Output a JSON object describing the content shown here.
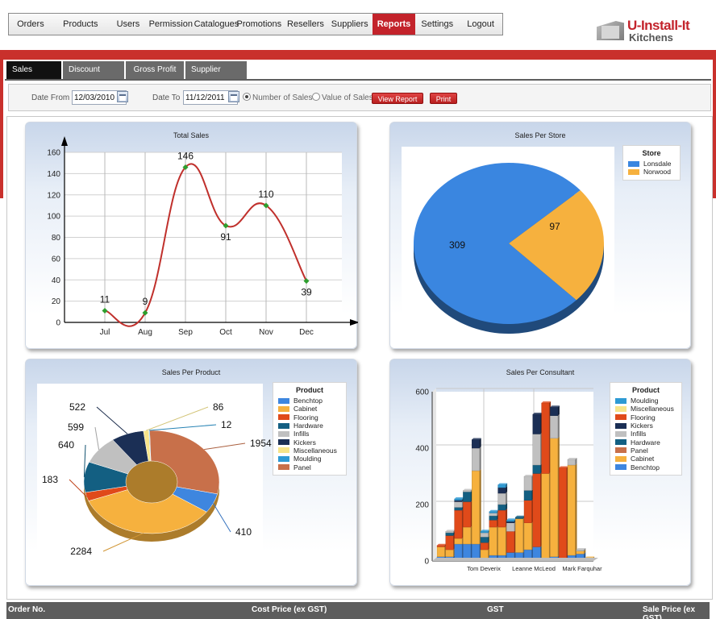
{
  "nav": {
    "items": [
      {
        "label": "Orders",
        "active": false
      },
      {
        "label": "Products",
        "active": false
      },
      {
        "label": "Users",
        "active": false
      },
      {
        "label": "Permission",
        "active": false
      },
      {
        "label": "Catalogues",
        "active": false
      },
      {
        "label": "Promotions",
        "active": false
      },
      {
        "label": "Resellers",
        "active": false
      },
      {
        "label": "Suppliers",
        "active": false
      },
      {
        "label": "Reports",
        "active": true
      },
      {
        "label": "Settings",
        "active": false
      },
      {
        "label": "Logout",
        "active": false
      }
    ]
  },
  "logo": {
    "line1": "U-Install-It",
    "line2": "Kitchens"
  },
  "tabs": [
    "Sales Report",
    "Discount Report",
    "Gross Profit",
    "Supplier Report"
  ],
  "filter": {
    "date_from_label": "Date From",
    "date_from": "12/03/2010",
    "date_to_label": "Date To",
    "date_to": "11/12/2011",
    "radio_number": "Number of Sales",
    "radio_value": "Value of Sales",
    "view_button": "View Report",
    "print_button": "Print"
  },
  "table_header": {
    "order_no": "Order No.",
    "cost_price": "Cost Price (ex GST)",
    "gst": "GST",
    "sale_price": "Sale Price (ex GST)"
  },
  "colors": {
    "accent": "#c3232b",
    "line": "#c0302c",
    "marker": "#2e9e2e"
  },
  "chart_data": [
    {
      "type": "line",
      "title": "Total Sales",
      "categories": [
        "Jul",
        "Aug",
        "Sep",
        "Oct",
        "Nov",
        "Dec"
      ],
      "values": [
        11,
        9,
        146,
        91,
        110,
        39
      ],
      "data_labels": [
        "11",
        "9",
        "146",
        "91",
        "110",
        "39"
      ],
      "ylim": [
        0,
        160
      ],
      "yticks": [
        "0",
        "20",
        "40",
        "60",
        "80",
        "100",
        "120",
        "140",
        "160"
      ],
      "grid": true
    },
    {
      "type": "pie",
      "title": "Sales Per Store",
      "legend_title": "Store",
      "legend": "top-right",
      "slices": [
        {
          "name": "Lonsdale",
          "value": 309,
          "label": "309",
          "color": "#3a86e0"
        },
        {
          "name": "Norwood",
          "value": 97,
          "label": "97",
          "color": "#f6b13e"
        }
      ]
    },
    {
      "type": "pie",
      "title": "Sales Per Product",
      "legend_title": "Product",
      "legend": "right",
      "slices": [
        {
          "name": "Panel",
          "value": 1954,
          "label": "1954",
          "color": "#c8704a"
        },
        {
          "name": "Benchtop",
          "value": 410,
          "label": "410",
          "color": "#3e86df"
        },
        {
          "name": "Cabinet",
          "value": 2284,
          "label": "2284",
          "color": "#f6b13e"
        },
        {
          "name": "Flooring",
          "value": 183,
          "label": "183",
          "color": "#e04a1a"
        },
        {
          "name": "Hardware",
          "value": 640,
          "label": "640",
          "color": "#135f82"
        },
        {
          "name": "Infills",
          "value": 599,
          "label": "599",
          "color": "#c0c0c0"
        },
        {
          "name": "Kickers",
          "value": 522,
          "label": "522",
          "color": "#1b2f55"
        },
        {
          "name": "Miscellaneous",
          "value": 86,
          "label": "86",
          "color": "#f7e58a"
        },
        {
          "name": "Moulding",
          "value": 12,
          "label": "12",
          "color": "#2e9ad4"
        }
      ],
      "legend_order": [
        "Benchtop",
        "Cabinet",
        "Flooring",
        "Hardware",
        "Infills",
        "Kickers",
        "Miscellaneous",
        "Moulding",
        "Panel"
      ]
    },
    {
      "type": "bar",
      "stacked": true,
      "title": "Sales Per Consultant",
      "legend_title": "Product",
      "legend": "right",
      "ylim": [
        0,
        600
      ],
      "yticks": [
        "0",
        "200",
        "400",
        "600"
      ],
      "x_tick_labels": [
        "Tom Deverix",
        "Leanne McLeod",
        "Mark Farquhar"
      ],
      "series_order_bottom_to_top": [
        "Benchtop",
        "Cabinet",
        "Panel",
        "Hardware",
        "Infills",
        "Kickers",
        "Miscellaneous",
        "Moulding"
      ],
      "series_colors": {
        "Benchtop": "#3e86df",
        "Cabinet": "#f6b13e",
        "Panel": "#e04a1a",
        "Hardware": "#135f82",
        "Infills": "#c0c0c0",
        "Kickers": "#1b2f55",
        "Miscellaneous": "#f7e58a",
        "Moulding": "#2e9ad4"
      },
      "bars": [
        [
          15,
          35,
          5,
          0,
          0,
          0,
          0,
          0
        ],
        [
          15,
          25,
          50,
          10,
          5,
          0,
          0,
          0
        ],
        [
          60,
          20,
          100,
          10,
          20,
          5,
          0,
          5
        ],
        [
          60,
          60,
          90,
          35,
          5,
          0,
          0,
          0
        ],
        [
          60,
          260,
          0,
          0,
          80,
          30,
          0,
          0
        ],
        [
          10,
          30,
          25,
          20,
          15,
          0,
          0,
          5
        ],
        [
          20,
          100,
          25,
          15,
          10,
          0,
          0,
          5
        ],
        [
          20,
          100,
          60,
          20,
          40,
          20,
          0,
          10
        ],
        [
          30,
          0,
          75,
          0,
          30,
          5,
          0,
          5
        ],
        [
          30,
          120,
          0,
          5,
          0,
          0,
          0,
          0
        ],
        [
          40,
          95,
          80,
          35,
          50,
          0,
          0,
          0
        ],
        [
          50,
          0,
          260,
          30,
          110,
          70,
          0,
          0
        ],
        [
          10,
          300,
          250,
          0,
          0,
          0,
          0,
          0
        ],
        [
          15,
          420,
          0,
          0,
          80,
          30,
          0,
          0
        ],
        [
          0,
          0,
          330,
          0,
          0,
          0,
          0,
          0
        ],
        [
          20,
          320,
          0,
          0,
          20,
          0,
          0,
          0
        ],
        [
          25,
          10,
          0,
          0,
          5,
          0,
          0,
          0
        ],
        [
          5,
          5,
          0,
          0,
          0,
          0,
          0,
          0
        ]
      ]
    }
  ]
}
